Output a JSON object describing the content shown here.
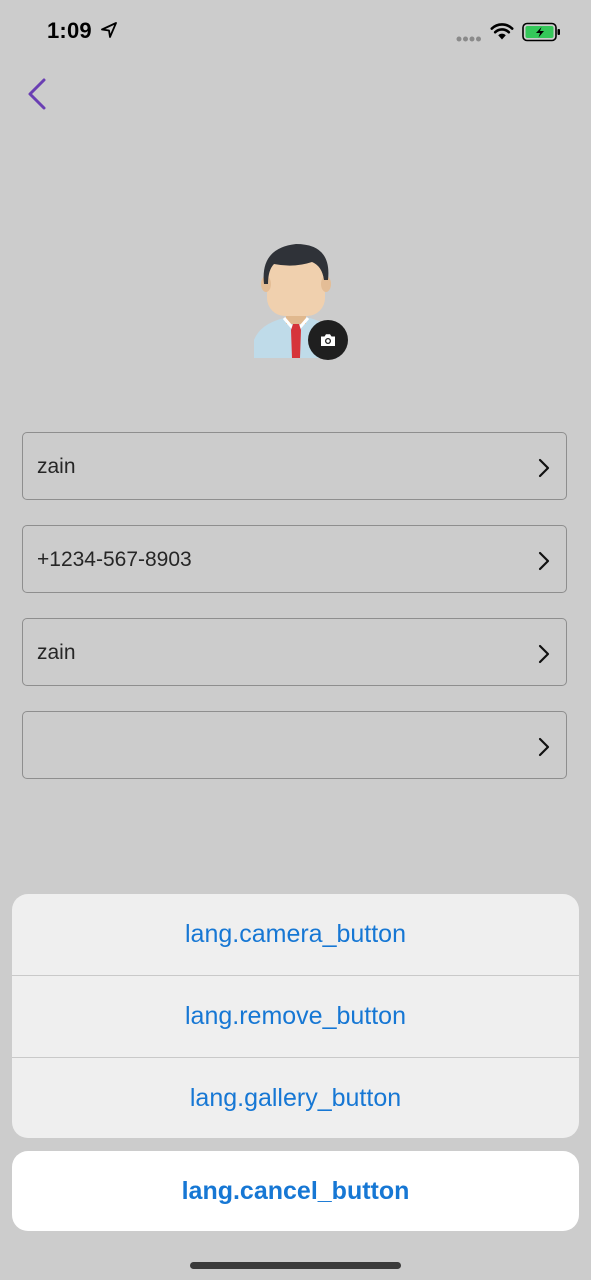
{
  "status_bar": {
    "time": "1:09",
    "battery_color": "#34c759"
  },
  "icons": {
    "back": "chevron-left-icon",
    "camera": "camera-icon",
    "row_chevron": "chevron-right-icon"
  },
  "accent_color": "#6a3fb3",
  "fields": [
    {
      "value": "zain"
    },
    {
      "value": "+1234-567-8903"
    },
    {
      "value": "zain"
    },
    {
      "value": ""
    }
  ],
  "action_sheet": {
    "camera_label": "lang.camera_button",
    "remove_label": "lang.remove_button",
    "gallery_label": "lang.gallery_button",
    "cancel_label": "lang.cancel_button",
    "action_color": "#1677d4"
  }
}
